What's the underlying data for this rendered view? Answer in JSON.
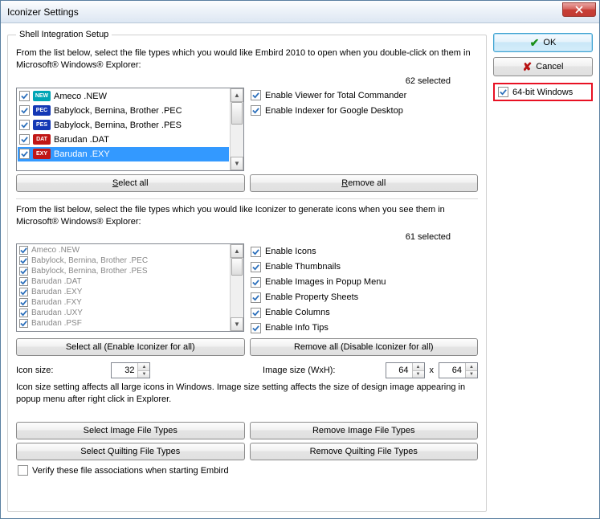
{
  "window": {
    "title": "Iconizer Settings"
  },
  "buttons": {
    "ok": "OK",
    "cancel": "Cancel",
    "select_all": "Select all",
    "remove_all": "Remove all",
    "select_all_iconizer": "Select all (Enable Iconizer for all)",
    "remove_all_iconizer": "Remove all (Disable Iconizer for all)",
    "select_image_types": "Select Image File Types",
    "remove_image_types": "Remove Image File Types",
    "select_quilting_types": "Select Quilting File Types",
    "remove_quilting_types": "Remove Quilting File Types"
  },
  "group_title": "Shell Integration Setup",
  "desc1": "From the list below, select the file types which you would like Embird 2010 to open when you double-click on them in Microsoft® Windows® Explorer:",
  "sel1_count": "62 selected",
  "list1": [
    {
      "label": "Ameco .NEW",
      "badge": "NEW",
      "color": "#00a5b5"
    },
    {
      "label": "Babylock, Bernina, Brother .PEC",
      "badge": "PEC",
      "color": "#1438b5"
    },
    {
      "label": "Babylock, Bernina, Brother .PES",
      "badge": "PES",
      "color": "#1438b5"
    },
    {
      "label": "Barudan .DAT",
      "badge": "DAT",
      "color": "#c01616"
    },
    {
      "label": "Barudan .EXY",
      "badge": "EXY",
      "color": "#c01616",
      "selected": true
    }
  ],
  "checks_top": [
    "Enable Viewer for Total Commander",
    "Enable Indexer for Google Desktop"
  ],
  "desc2": "From the list below, select the file types which you would like Iconizer to generate icons when you see them in Microsoft® Windows® Explorer:",
  "sel2_count": "61 selected",
  "list2": [
    "Ameco .NEW",
    "Babylock, Bernina, Brother .PEC",
    "Babylock, Bernina, Brother .PES",
    "Barudan .DAT",
    "Barudan .EXY",
    "Barudan .FXY",
    "Barudan .UXY",
    "Barudan .PSF"
  ],
  "checks_mid": [
    "Enable Icons",
    "Enable Thumbnails",
    "Enable Images in Popup Menu",
    "Enable Property Sheets",
    "Enable Columns",
    "Enable Info Tips"
  ],
  "sizes": {
    "icon_label": "Icon size:",
    "icon_value": "32",
    "image_label": "Image size (WxH):",
    "image_w": "64",
    "image_h": "64",
    "x": "x"
  },
  "size_desc": "Icon size setting affects all large icons in Windows. Image size setting affects the size of design image appearing in popup menu after right click in Explorer.",
  "verify_label": "Verify these file associations when starting Embird",
  "bit64_label": "64-bit Windows"
}
